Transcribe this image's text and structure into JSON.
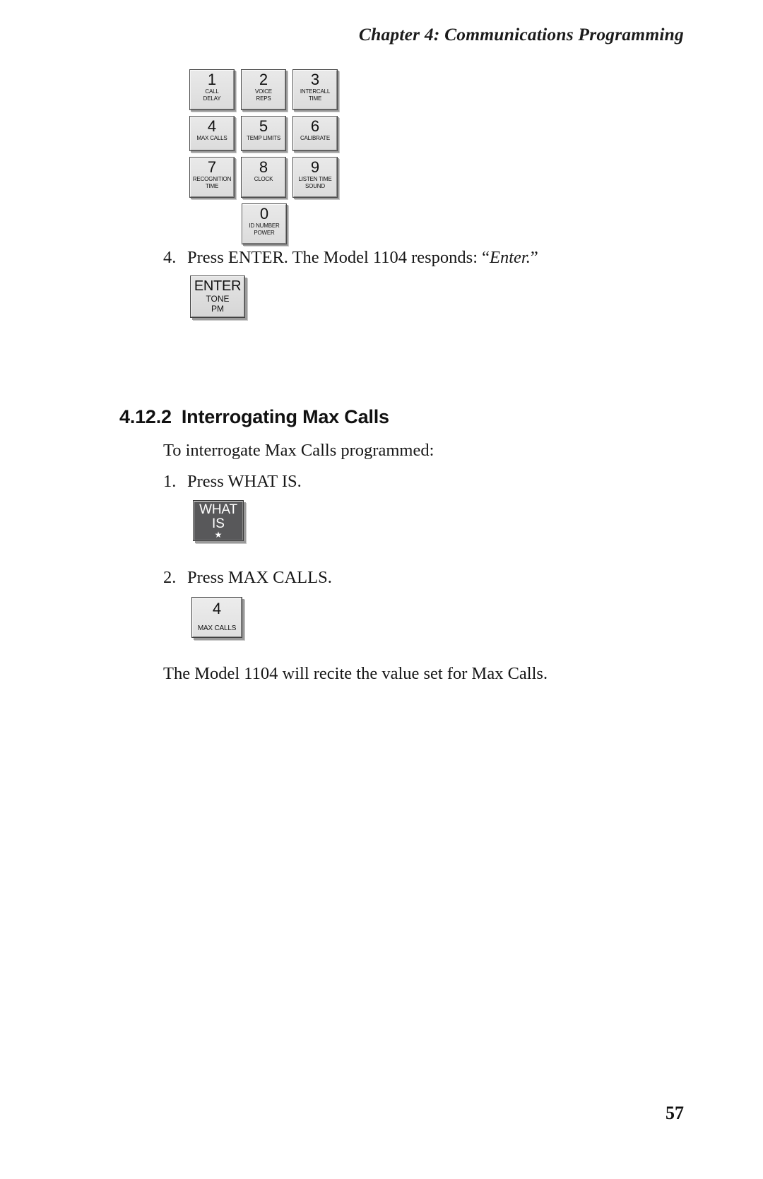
{
  "header": {
    "running_head": "Chapter 4:  Communications Programming"
  },
  "keypad": {
    "rows": [
      [
        {
          "digit": "1",
          "lines": [
            "CALL",
            "DELAY"
          ]
        },
        {
          "digit": "2",
          "lines": [
            "VOICE",
            "REPS"
          ]
        },
        {
          "digit": "3",
          "lines": [
            "INTERCALL",
            "TIME"
          ]
        }
      ],
      [
        {
          "digit": "4",
          "lines": [
            "MAX CALLS"
          ]
        },
        {
          "digit": "5",
          "lines": [
            "TEMP LIMITS"
          ]
        },
        {
          "digit": "6",
          "lines": [
            "CALIBRATE"
          ]
        }
      ],
      [
        {
          "digit": "7",
          "lines": [
            "RECOGNITION",
            "TIME"
          ]
        },
        {
          "digit": "8",
          "lines": [
            "CLOCK"
          ]
        },
        {
          "digit": "9",
          "lines": [
            "LISTEN TIME",
            "SOUND"
          ]
        }
      ]
    ],
    "zero_key": {
      "digit": "0",
      "lines": [
        "ID NUMBER",
        "POWER"
      ]
    }
  },
  "step4": {
    "number": "4.",
    "text_before": "Press ENTER. The Model 1104 responds: “",
    "emphasis": "Enter.",
    "text_after": "”"
  },
  "enter_key": {
    "main": "ENTER",
    "sub1": "TONE",
    "sub2": "PM"
  },
  "section": {
    "number": "4.12.2",
    "title": "Interrogating Max Calls",
    "intro": "To interrogate Max Calls programmed:"
  },
  "step1": {
    "number": "1.",
    "text": "Press WHAT IS."
  },
  "whatis_key": {
    "line1": "WHAT",
    "line2": "IS",
    "line3": "★"
  },
  "step2": {
    "number": "2.",
    "text": "Press MAX CALLS."
  },
  "maxcalls_key": {
    "digit": "4",
    "sub": "MAX CALLS"
  },
  "closing": {
    "text": "The Model 1104 will recite the value set for Max Calls."
  },
  "footer": {
    "page_number": "57"
  },
  "colors": {
    "key_face_light": "#e6e6e6",
    "key_face_dark": "#58585a",
    "key_outline": "#3f3f3f",
    "text": "#171717"
  }
}
